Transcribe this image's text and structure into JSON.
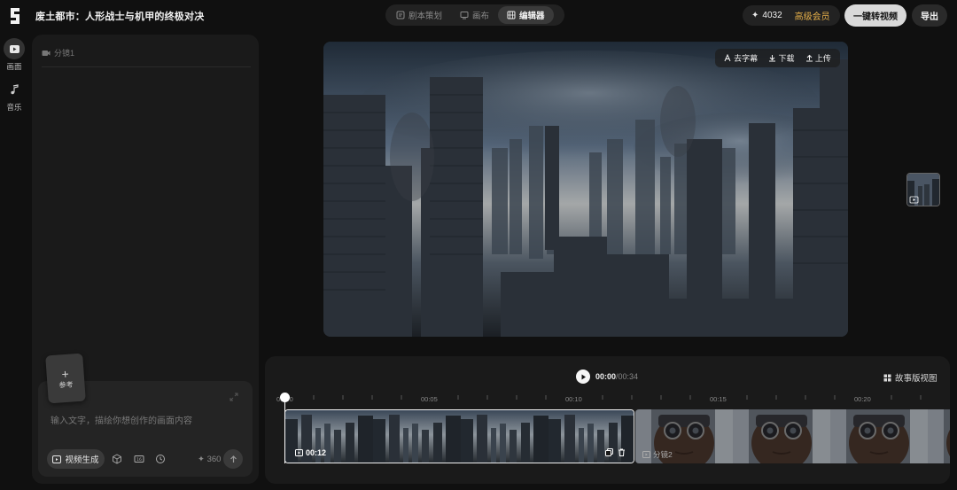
{
  "header": {
    "title": "废土都市：人形战士与机甲的终极对决",
    "tabs": [
      {
        "label": "剧本策划",
        "icon": "script-icon",
        "active": false
      },
      {
        "label": "画布",
        "icon": "canvas-icon",
        "active": false
      },
      {
        "label": "编辑器",
        "icon": "editor-icon",
        "active": true
      }
    ],
    "credits": "4032",
    "vip_label": "高级会员",
    "convert_label": "一键转视频",
    "export_label": "导出"
  },
  "rail": [
    {
      "label": "画面",
      "icon": "video-icon",
      "active": true
    },
    {
      "label": "音乐",
      "icon": "music-note-icon",
      "active": false
    }
  ],
  "panel": {
    "shot_label": "分镜1",
    "ref_label": "参考",
    "input_placeholder": "输入文字，描绘你想创作的画面内容",
    "gen_label": "视频生成",
    "cost": "360"
  },
  "preview": {
    "actions": [
      "去字幕",
      "下载",
      "上传"
    ]
  },
  "timeline": {
    "current": "00:00",
    "total": "/00:34",
    "storyboard_label": "故事版视图",
    "ticks": [
      "00:00",
      "00:05",
      "00:10",
      "00:15",
      "00:20"
    ],
    "clip1_duration": "00:12",
    "clip2_label": "分镜2"
  },
  "colors": {
    "accent_vip": "#e8b14a",
    "bg": "#101010",
    "panel": "#1a1a1a"
  }
}
